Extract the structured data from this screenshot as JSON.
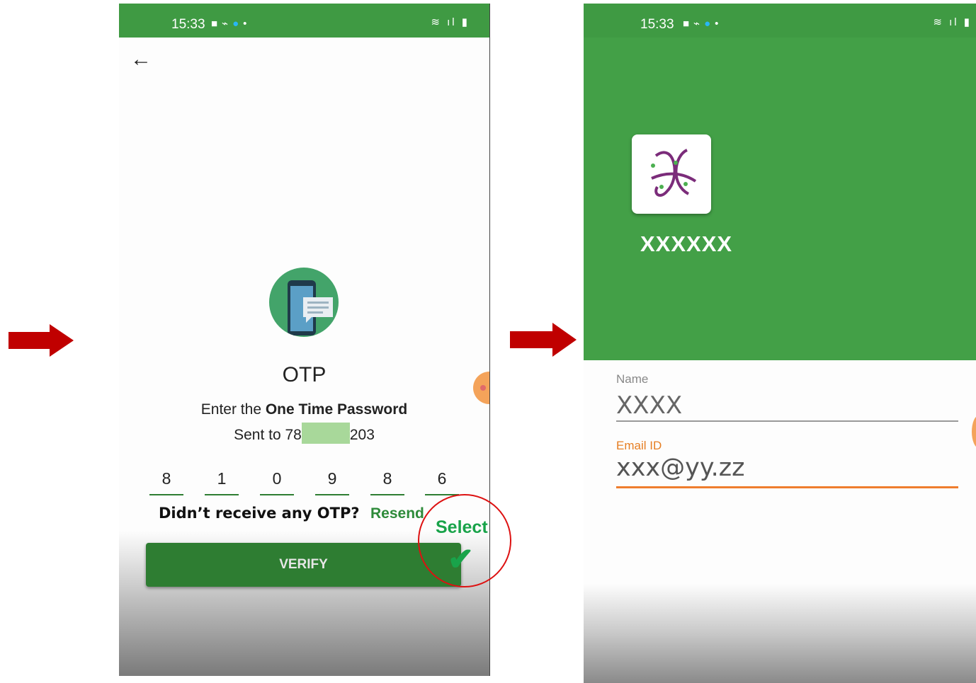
{
  "colors": {
    "brand_green": "#43a047",
    "dark_green": "#2e7d32",
    "accent_orange": "#ef7d2e",
    "arrow_red": "#c00000",
    "highlight_red": "#dd1111"
  },
  "screen_otp": {
    "status_time": "15:33",
    "title": "OTP",
    "instruction_prefix": "Enter the ",
    "instruction_bold": "One Time Password",
    "sent_prefix": "Sent to 78",
    "sent_suffix": "203",
    "digits": [
      "8",
      "1",
      "0",
      "9",
      "8",
      "6"
    ],
    "no_otp_question": "Didn’t receive any OTP?",
    "resend_label": "Resend",
    "verify_label": "VERIFY",
    "annotation_label": "Select"
  },
  "screen_profile": {
    "status_time": "15:33",
    "app_name": "XXXXXX",
    "name_label": "Name",
    "name_value": "XXXX",
    "email_label": "Email ID",
    "email_value": "xxx@yy.zz"
  }
}
